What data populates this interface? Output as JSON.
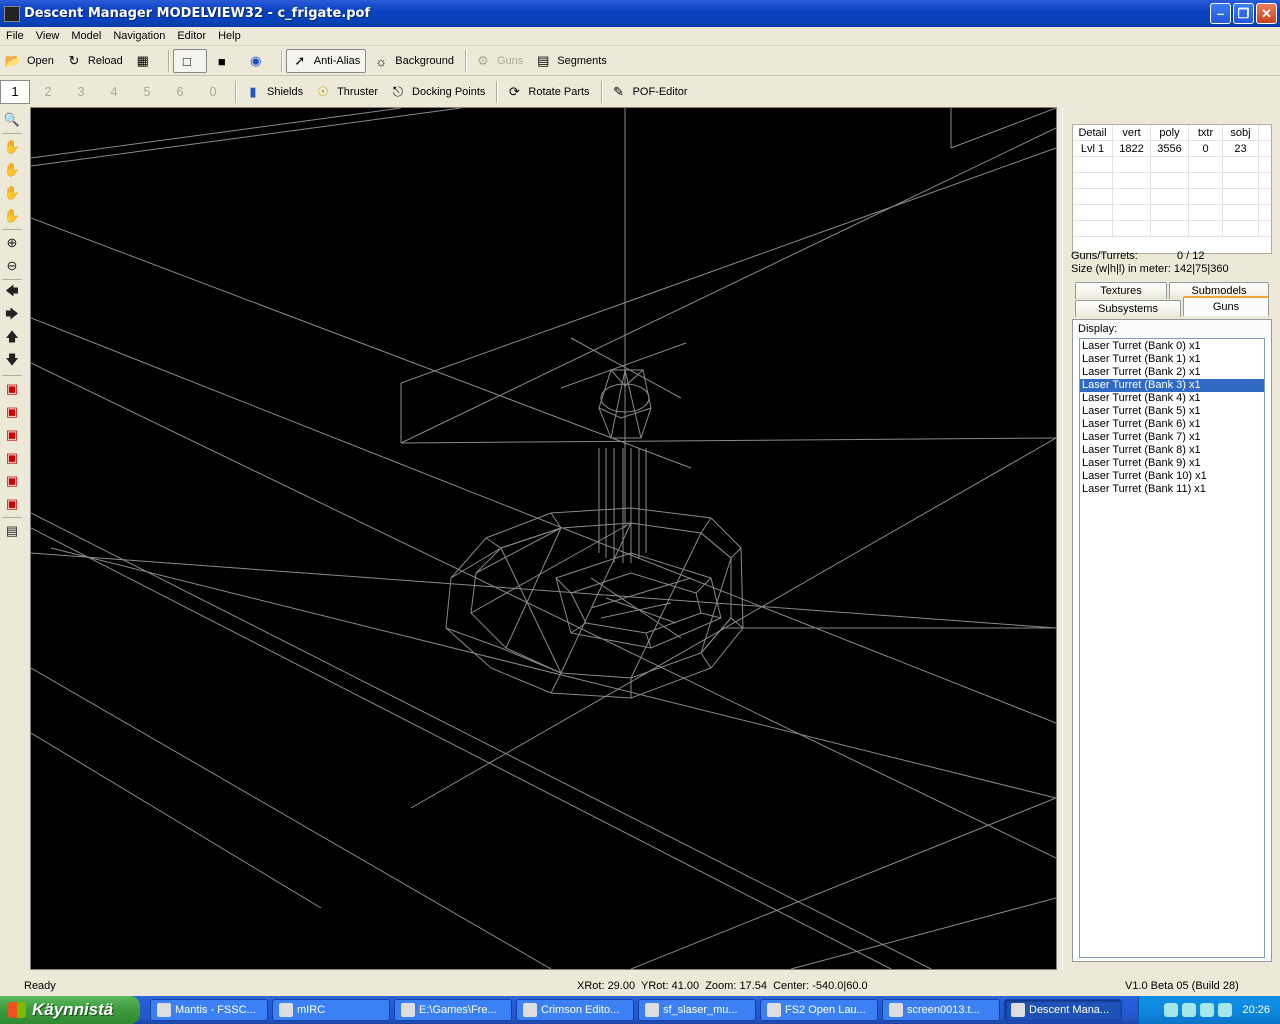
{
  "window": {
    "title": "Descent Manager MODELVIEW32 - c_frigate.pof",
    "buttons": [
      "minimize-icon",
      "maximize-icon",
      "close-icon"
    ]
  },
  "menu": [
    "File",
    "View",
    "Model",
    "Navigation",
    "Editor",
    "Help"
  ],
  "toolbar1": {
    "open": "Open",
    "reload": "Reload",
    "anti_alias": "Anti-Alias",
    "background": "Background",
    "guns": "Guns",
    "segments": "Segments"
  },
  "toolbar2": {
    "detail_levels": [
      "1",
      "2",
      "3",
      "4",
      "5",
      "6",
      "0"
    ],
    "shields": "Shields",
    "thruster": "Thruster",
    "docking_points": "Docking Points",
    "rotate_parts": "Rotate Parts",
    "pof_editor": "POF-Editor"
  },
  "detail_table": {
    "headers": [
      "Detail",
      "vert",
      "poly",
      "txtr",
      "sobj"
    ],
    "rows": [
      [
        "Lvl 1",
        "1822",
        "3556",
        "0",
        "23"
      ]
    ]
  },
  "info": {
    "guns_label": "Guns/Turrets:",
    "guns_value": "0 / 12",
    "size_label": "Size (w|h|l) in meter:",
    "size_value": "142|75|360"
  },
  "tabs": {
    "textures": "Textures",
    "submodels": "Submodels",
    "subsystems": "Subsystems",
    "guns": "Guns"
  },
  "display_label": "Display:",
  "gun_list": [
    "Laser Turret (Bank 0) x1",
    "Laser Turret (Bank 1) x1",
    "Laser Turret (Bank 2) x1",
    "Laser Turret (Bank 3) x1",
    "Laser Turret (Bank 4) x1",
    "Laser Turret (Bank 5) x1",
    "Laser Turret (Bank 6) x1",
    "Laser Turret (Bank 7) x1",
    "Laser Turret (Bank 8) x1",
    "Laser Turret (Bank 9) x1",
    "Laser Turret (Bank 10) x1",
    "Laser Turret (Bank 11) x1"
  ],
  "selected_gun": 3,
  "status": {
    "ready": "Ready",
    "coords": "XRot: 29.00  YRot: 41.00  Zoom: 17.54  Center: -540.0|60.0",
    "version": "V1.0 Beta 05 (Build 28)"
  },
  "taskbar": {
    "start": "Käynnistä",
    "tasks": [
      "Mantis - FSSC...",
      "mIRC",
      "E:\\Games\\Fre...",
      "Crimson Edito...",
      "sf_slaser_mu...",
      "FS2 Open Lau...",
      "screen0013.t...",
      "Descent Mana..."
    ],
    "active_task": 7,
    "clock": "20:26"
  },
  "colors": {
    "viewport_bg": "#000000",
    "wire": "#8a8a8a",
    "selection": "#316ac5"
  }
}
